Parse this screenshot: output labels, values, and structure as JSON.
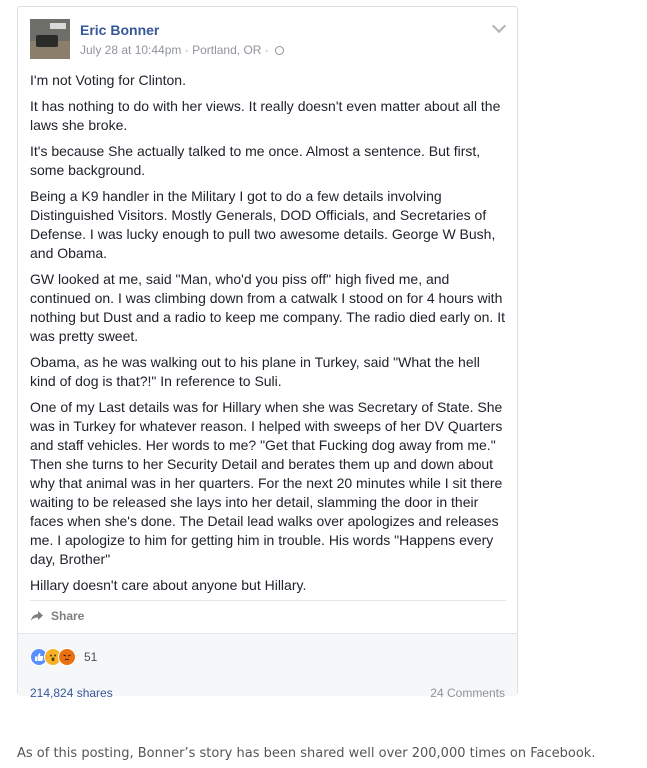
{
  "post": {
    "author": "Eric Bonner",
    "timestamp": "July 28 at 10:44pm",
    "separator": " · ",
    "location": "Portland, OR",
    "paragraphs": [
      "I'm not Voting for Clinton.",
      "It has nothing to do with her views. It really doesn't even matter about all the laws she broke.",
      "It's because She actually talked to me once. Almost a sentence. But first, some background.",
      "Being a K9 handler in the Military I got to do a few details involving Distinguished Visitors. Mostly Generals, DOD Officials, and Secretaries of Defense. I was lucky enough to pull two awesome details. George W Bush, and Obama.",
      "GW looked at me, said \"Man, who'd you piss off\" high fived me, and continued on. I was climbing down from a catwalk I stood on for 4 hours with nothing but Dust and a radio to keep me company. The radio died early on. It was pretty sweet.",
      "Obama, as he was walking out to his plane in Turkey, said \"What the hell kind of dog is that?!\" In reference to Suli.",
      "One of my Last details was for Hillary when she was Secretary of State. She was in Turkey for whatever reason. I helped with sweeps of her DV Quarters and staff vehicles. Her words to me? \"Get that Fucking dog away from me.\" Then she turns to her Security Detail and berates them up and down about why that animal was in her quarters. For the next 20 minutes while I sit there waiting to be released she lays into her detail, slamming the door in their faces when she's done. The Detail lead walks over apologizes and releases me. I apologize to him for getting him in trouble. His words \"Happens every day, Brother\"",
      "Hillary doesn't care about anyone but Hillary."
    ],
    "share_label": "Share",
    "reaction_count": "51",
    "shares_text": "214,824 shares",
    "comments_text": "24 Comments"
  },
  "caption": "As of this posting, Bonner’s story has been shared well over 200,000 times on Facebook.",
  "icons": {
    "avatar": "profile-photo",
    "privacy": "globe-icon",
    "menu": "chevron-down-icon",
    "share": "share-arrow-icon",
    "reactions": [
      "like-icon",
      "wow-icon",
      "angry-icon"
    ]
  },
  "colors": {
    "link_blue": "#365899",
    "meta_gray": "#90949c",
    "footer_bg": "#f6f7f9",
    "like_blue": "#5890ff"
  }
}
